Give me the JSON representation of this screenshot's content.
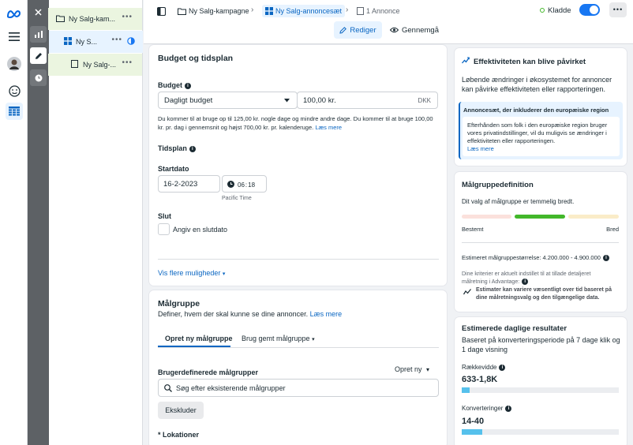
{
  "breadcrumbs": {
    "campaign": "Ny Salg-kampagne",
    "adset": "Ny Salg-annoncesæt",
    "ads": "1 Annonce"
  },
  "status": {
    "label": "Kladde"
  },
  "mode_tabs": {
    "edit": "Rediger",
    "review": "Gennemgå"
  },
  "tree": {
    "campaign": "Ny Salg-kam...",
    "adset": "Ny S...",
    "ad": "Ny Salg-..."
  },
  "budget_section": {
    "title": "Budget og tidsplan",
    "budget_label": "Budget",
    "budget_type": "Dagligt budget",
    "budget_value": "100,00 kr.",
    "currency": "DKK",
    "note_line1": "Du kommer til at bruge op til 125,00 kr. nogle dage og mindre andre dage. Du kommer til at bruge 100,00",
    "note_line2": "kr. pr. dag i gennemsnit og højst 700,00 kr. pr. kalenderuge.",
    "learn_more": "Læs mere",
    "schedule_label": "Tidsplan",
    "start_label": "Startdato",
    "start_date": "16-2-2023",
    "start_hour": "06",
    "start_minute": "18",
    "timezone": "Pacific Time",
    "end_label": "Slut",
    "end_checkbox": "Angiv en slutdato",
    "more_options": "Vis flere muligheder"
  },
  "audience_section": {
    "title": "Målgruppe",
    "subtitle": "Definer, hvem der skal kunne se dine annoncer.",
    "learn_more": "Læs mere",
    "tab_new": "Opret ny målgruppe",
    "tab_saved": "Brug gemt målgruppe",
    "custom_label": "Brugerdefinerede målgrupper",
    "create_new": "Opret ny",
    "search_placeholder": "Søg efter eksisterende målgrupper",
    "exclude": "Ekskluder",
    "locations": "* Lokationer"
  },
  "effect_card": {
    "title": "Effektiviteten kan blive påvirket",
    "body_line1": "Løbende ændringer i økosystemet for annoncer",
    "body_line2": "kan påvirke effektiviteten eller rapporteringen.",
    "notice_title": "Annoncesæt, der inkluderer den europæiske region",
    "notice_line1": "Efterhånden som folk i den europæiske region bruger",
    "notice_line2": "vores privatindstillinger, vil du muligvis se ændringer i",
    "notice_line3": "effektiviteten eller rapporteringen.",
    "notice_link": "Læs mere"
  },
  "audience_def": {
    "title": "Målgruppedefinition",
    "summary": "Dit valg af målgruppe er temmelig bredt.",
    "left_label": "Bestemt",
    "right_label": "Bred",
    "size_text": "Estimeret målgruppestørrelse: 4.200.000 - 4.900.000",
    "criteria_line1": "Dine kriterier er aktuelt indstillet til at tillade detaljeret",
    "criteria_line2": "målretning i Advantage:",
    "estimate_line1": "Estimater kan variere væsentligt over tid baseret på",
    "estimate_line2": "dine målretningsvalg og den tilgængelige data."
  },
  "daily_results": {
    "title": "Estimerede daglige resultater",
    "subtitle_line1": "Baseret på konverteringsperiode på 7 dage klik og",
    "subtitle_line2": "1 dage visning",
    "reach_label": "Rækkevidde",
    "reach_value": "633-1,8K",
    "reach_fill": 0.05,
    "conv_label": "Konverteringer",
    "conv_value": "14-40",
    "conv_fill": 0.13
  },
  "colors": {
    "accent": "#0a66c2",
    "green": "#42b72a",
    "toggle": "#1877f2"
  }
}
